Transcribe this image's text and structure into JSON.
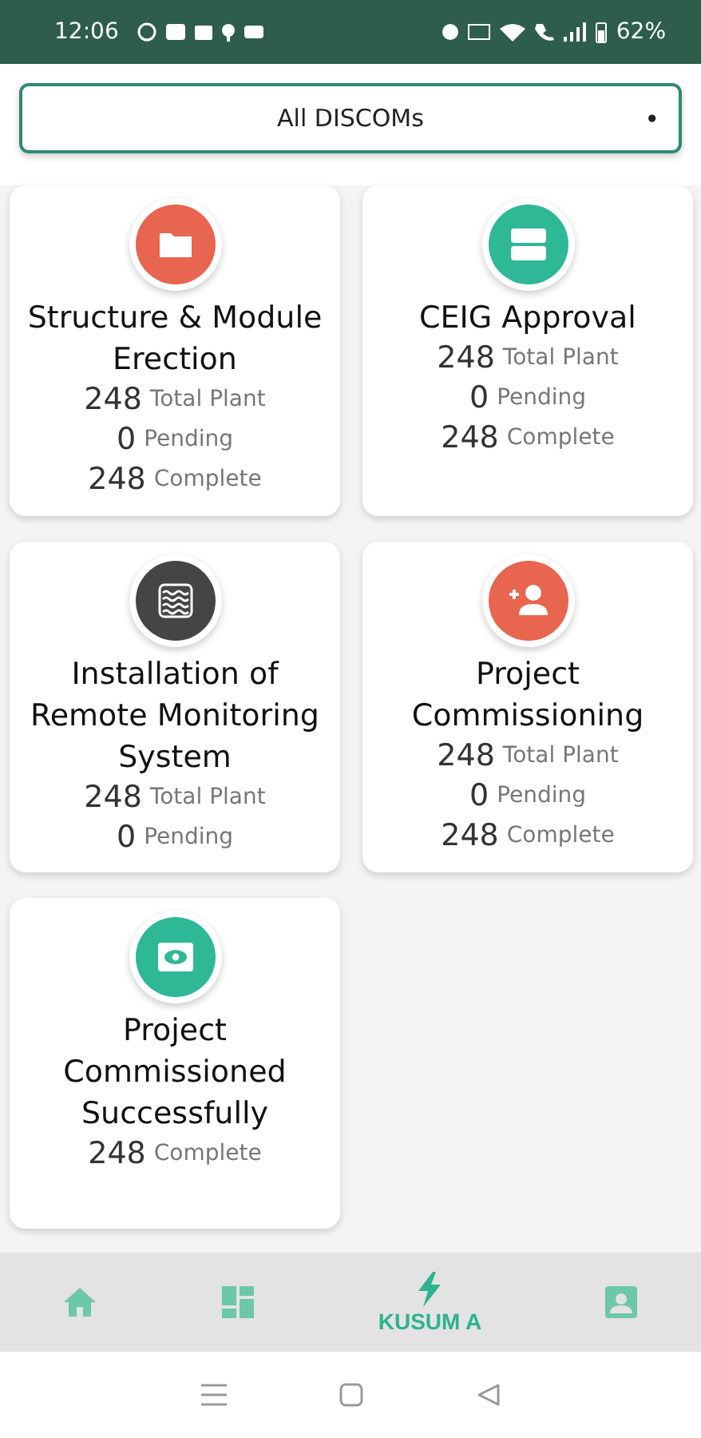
{
  "status_bar": {
    "time": "12:06",
    "battery": "62%"
  },
  "filter": {
    "value": "All DISCOMs",
    "marker": "•"
  },
  "cards": [
    {
      "title": "Structure & Module Erection",
      "kind": "folder",
      "color": "#e8654f",
      "stats": [
        {
          "count": "248",
          "unit": "Total Plant"
        },
        {
          "count": "0",
          "unit": "Pending"
        },
        {
          "count": "248",
          "unit": "Complete"
        }
      ]
    },
    {
      "title": "CEIG Approval",
      "kind": "panel",
      "color": "#2fb896",
      "stats": [
        {
          "count": "248",
          "unit": "Total Plant"
        },
        {
          "count": "0",
          "unit": "Pending"
        },
        {
          "count": "248",
          "unit": "Complete"
        }
      ]
    },
    {
      "title": "Installation of Remote Monitoring System",
      "kind": "waves",
      "color": "#454545",
      "stats": [
        {
          "count": "248",
          "unit": "Total Plant"
        },
        {
          "count": "0",
          "unit": "Pending"
        }
      ]
    },
    {
      "title": "Project Commissioning",
      "kind": "person-add",
      "color": "#e8654f",
      "stats": [
        {
          "count": "248",
          "unit": "Total Plant"
        },
        {
          "count": "0",
          "unit": "Pending"
        },
        {
          "count": "248",
          "unit": "Complete"
        }
      ]
    },
    {
      "title": "Project Commissioned Successfully",
      "kind": "eye",
      "color": "#2fb896",
      "stats": [
        {
          "count": "248",
          "unit": "Complete"
        }
      ]
    }
  ],
  "bottom_nav": [
    {
      "kind": "home",
      "selected": false
    },
    {
      "kind": "dashboard",
      "selected": false
    },
    {
      "kind": "bolt",
      "label": "KUSUM A",
      "selected": true
    },
    {
      "kind": "profile",
      "selected": false
    }
  ]
}
